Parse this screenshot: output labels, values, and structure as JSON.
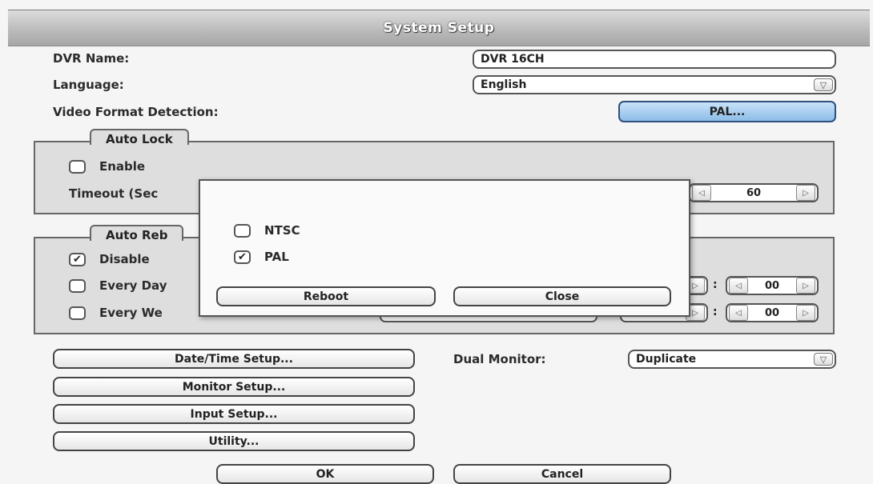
{
  "window": {
    "title": "System Setup"
  },
  "general": {
    "dvr_name_label": "DVR Name:",
    "dvr_name_value": "DVR 16CH",
    "language_label": "Language:",
    "language_value": "English",
    "video_format_label": "Video Format Detection:",
    "video_format_button": "PAL..."
  },
  "auto_lock": {
    "title": "Auto Lock",
    "enable_label": "Enable",
    "enable_checked": false,
    "timeout_label": "Timeout (Sec",
    "timeout_value": "60"
  },
  "auto_reboot": {
    "title": "Auto Reb",
    "disable_label": "Disable",
    "disable_checked": true,
    "every_day_label": "Every Day",
    "every_week_label": "Every We",
    "time_row1": {
      "hour": "",
      "minute": "00"
    },
    "time_row2": {
      "hour": "",
      "minute": "00"
    }
  },
  "buttons": {
    "date_time": "Date/Time Setup...",
    "monitor": "Monitor Setup...",
    "input": "Input Setup...",
    "utility": "Utility...",
    "ok": "OK",
    "cancel": "Cancel"
  },
  "dual_monitor": {
    "label": "Dual Monitor:",
    "value": "Duplicate"
  },
  "format_dialog": {
    "ntsc_label": "NTSC",
    "ntsc_checked": false,
    "pal_label": "PAL",
    "pal_checked": true,
    "reboot_button": "Reboot",
    "close_button": "Close"
  },
  "icons": {
    "dropdown": "chevron-down-icon",
    "spin_left": "triangle-left-icon",
    "spin_right": "triangle-right-icon",
    "check": "checkmark-icon"
  },
  "colors": {
    "accent": "#8cbde8",
    "title_bar": "#b9b9b9",
    "group_bg": "#dedede"
  }
}
